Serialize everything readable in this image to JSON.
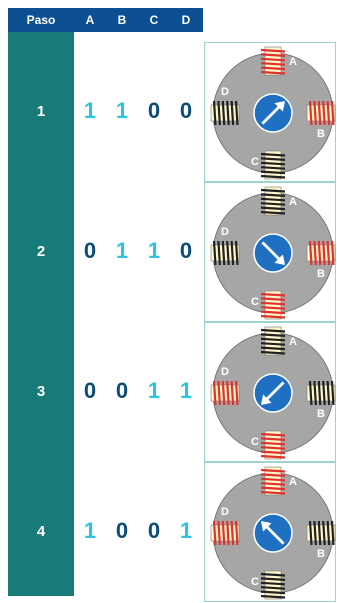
{
  "header": {
    "paso": "Paso",
    "cols": [
      "A",
      "B",
      "C",
      "D"
    ]
  },
  "steps": [
    {
      "label": "1",
      "values": [
        "1",
        "1",
        "0",
        "0"
      ],
      "arrow_deg": 45,
      "coils_on": [
        "A",
        "B"
      ]
    },
    {
      "label": "2",
      "values": [
        "0",
        "1",
        "1",
        "0"
      ],
      "arrow_deg": 135,
      "coils_on": [
        "B",
        "C"
      ]
    },
    {
      "label": "3",
      "values": [
        "0",
        "0",
        "1",
        "1"
      ],
      "arrow_deg": 225,
      "coils_on": [
        "C",
        "D"
      ]
    },
    {
      "label": "4",
      "values": [
        "1",
        "0",
        "0",
        "1"
      ],
      "arrow_deg": 315,
      "coils_on": [
        "D",
        "A"
      ]
    }
  ],
  "coil_labels": {
    "A": "A",
    "B": "B",
    "C": "C",
    "D": "D"
  },
  "colors": {
    "header_bg": "#0d4f93",
    "paso_bg": "#167b79",
    "value_on": "#2ec4de",
    "value_off": "#0b4d78",
    "coil_on": "#e0322e",
    "coil_off": "#222222",
    "motor_body": "#a6a6a6",
    "rotor": "#1f6fc2"
  }
}
